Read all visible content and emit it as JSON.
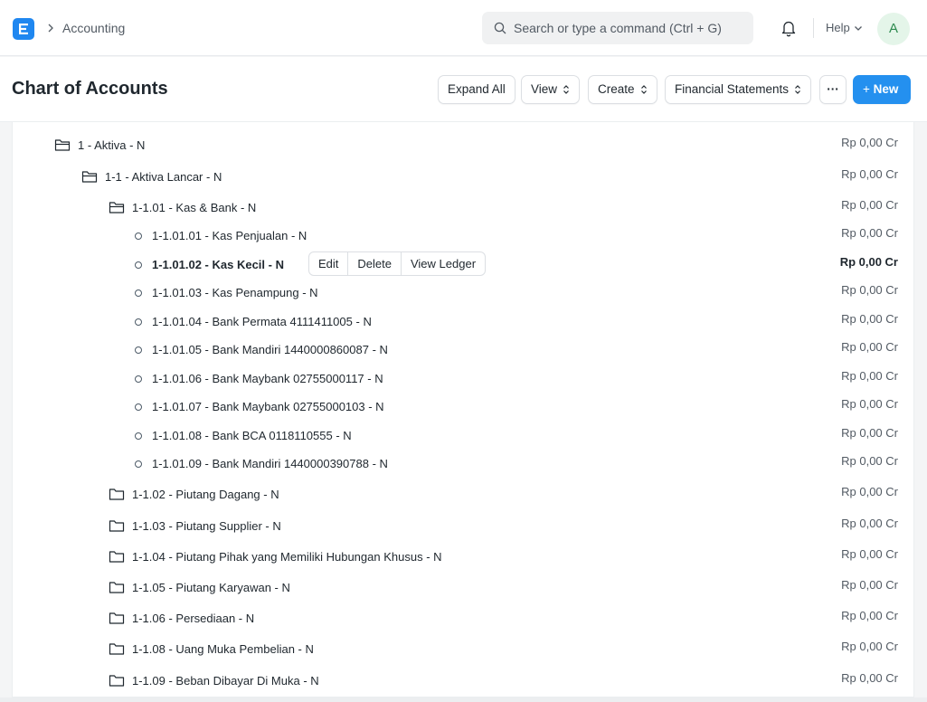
{
  "navbar": {
    "breadcrumb": "Accounting",
    "search_placeholder": "Search or type a command (Ctrl + G)",
    "help_label": "Help",
    "avatar_initial": "A"
  },
  "page": {
    "title": "Chart of Accounts",
    "buttons": {
      "expand_all": "Expand All",
      "view": "View",
      "create": "Create",
      "financial_statements": "Financial Statements",
      "more": "···",
      "new": "New"
    }
  },
  "row_actions": {
    "edit": "Edit",
    "delete": "Delete",
    "view_ledger": "View Ledger"
  },
  "tree": [
    {
      "label": "1 - Aktiva",
      "suffix": " - N",
      "balance": "Rp 0,00 Cr",
      "type": "group",
      "level": 0
    },
    {
      "label": "1-1 - Aktiva Lancar",
      "suffix": " - N",
      "balance": "Rp 0,00 Cr",
      "type": "group",
      "level": 1
    },
    {
      "label": "1-1.01 - Kas & Bank",
      "suffix": " - N",
      "balance": "Rp 0,00 Cr",
      "type": "group",
      "level": 2
    },
    {
      "label": "1-1.01.01 - Kas Penjualan",
      "suffix": " - N",
      "balance": "Rp 0,00 Cr",
      "type": "leaf",
      "level": 3
    },
    {
      "label": "1-1.01.02 - Kas Kecil",
      "suffix": " - N",
      "balance": "Rp 0,00 Cr",
      "type": "leaf",
      "level": 3,
      "active": true
    },
    {
      "label": "1-1.01.03 - Kas Penampung",
      "suffix": " - N",
      "balance": "Rp 0,00 Cr",
      "type": "leaf",
      "level": 3
    },
    {
      "label": "1-1.01.04 - Bank Permata 4111411005",
      "suffix": " - N",
      "balance": "Rp 0,00 Cr",
      "type": "leaf",
      "level": 3
    },
    {
      "label": "1-1.01.05 - Bank Mandiri 1440000860087",
      "suffix": " - N",
      "balance": "Rp 0,00 Cr",
      "type": "leaf",
      "level": 3
    },
    {
      "label": "1-1.01.06 - Bank Maybank 02755000117",
      "suffix": " - N",
      "balance": "Rp 0,00 Cr",
      "type": "leaf",
      "level": 3
    },
    {
      "label": "1-1.01.07 - Bank Maybank 02755000103",
      "suffix": " - N",
      "balance": "Rp 0,00 Cr",
      "type": "leaf",
      "level": 3
    },
    {
      "label": "1-1.01.08 - Bank BCA 0118110555",
      "suffix": " - N",
      "balance": "Rp 0,00 Cr",
      "type": "leaf",
      "level": 3
    },
    {
      "label": "1-1.01.09 - Bank Mandiri 1440000390788",
      "suffix": " - N",
      "balance": "Rp 0,00 Cr",
      "type": "leaf",
      "level": 3
    },
    {
      "label": "1-1.02 - Piutang Dagang",
      "suffix": " - N",
      "balance": "Rp 0,00 Cr",
      "type": "group-closed",
      "level": 2
    },
    {
      "label": "1-1.03 - Piutang Supplier",
      "suffix": " - N",
      "balance": "Rp 0,00 Cr",
      "type": "group-closed",
      "level": 2
    },
    {
      "label": "1-1.04 - Piutang Pihak yang Memiliki Hubungan Khusus",
      "suffix": " - N",
      "balance": "Rp 0,00 Cr",
      "type": "group-closed",
      "level": 2
    },
    {
      "label": "1-1.05 - Piutang Karyawan",
      "suffix": " - N",
      "balance": "Rp 0,00 Cr",
      "type": "group-closed",
      "level": 2
    },
    {
      "label": "1-1.06 - Persediaan",
      "suffix": " - N",
      "balance": "Rp 0,00 Cr",
      "type": "group-closed",
      "level": 2
    },
    {
      "label": "1-1.08 - Uang Muka Pembelian",
      "suffix": " - N",
      "balance": "Rp 0,00 Cr",
      "type": "group-closed",
      "level": 2
    },
    {
      "label": "1-1.09 - Beban Dibayar Di Muka",
      "suffix": " - N",
      "balance": "Rp 0,00 Cr",
      "type": "group-closed",
      "level": 2
    }
  ]
}
